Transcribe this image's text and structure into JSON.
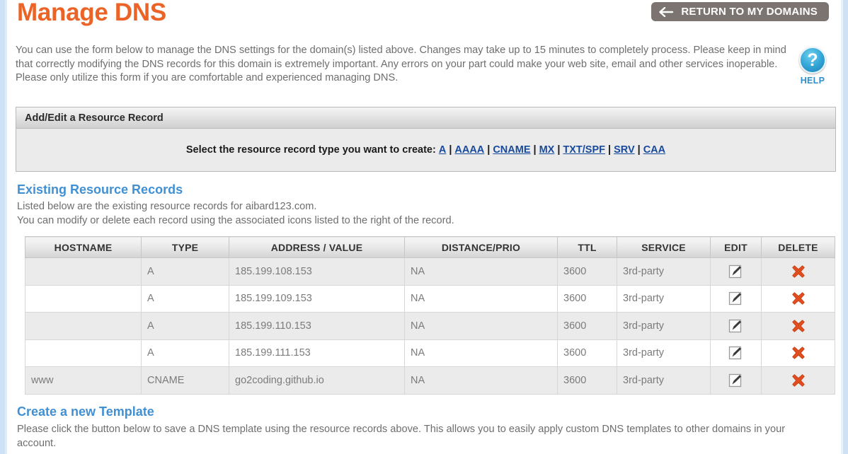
{
  "header": {
    "title": "Manage DNS",
    "return_button": "RETURN TO MY DOMAINS",
    "back_arrow_icon": "arrow-left-icon"
  },
  "intro": "You can use the form below to manage the DNS settings for the domain(s) listed above. Changes may take up to 15 minutes to completely process. Please keep in mind that correctly modifying the DNS records for this domain is extremely important. Any errors on your part could make your web site, email and other services inoperable. Please only utilize this form if you are comfortable and experienced managing DNS.",
  "help": {
    "glyph": "?",
    "label": "HELP",
    "icon": "question-mark-icon",
    "color": "#2d8fd0"
  },
  "add_edit_panel": {
    "title": "Add/Edit a Resource Record",
    "prompt": "Select the resource record type you want to create:",
    "record_types": [
      "A",
      "AAAA",
      "CNAME",
      "MX",
      "TXT/SPF",
      "SRV",
      "CAA"
    ],
    "separator": "|",
    "link_color": "#17499c"
  },
  "existing_records": {
    "heading": "Existing Resource Records",
    "subtext_line1": "Listed below are the existing resource records for aibard123.com.",
    "subtext_line2": "You can modify or delete each record using the associated icons listed to the right of the record.",
    "columns": [
      "HOSTNAME",
      "TYPE",
      "ADDRESS / VALUE",
      "DISTANCE/PRIO",
      "TTL",
      "SERVICE",
      "EDIT",
      "DELETE"
    ],
    "rows": [
      {
        "hostname": "",
        "type": "A",
        "address": "185.199.108.153",
        "distance": "NA",
        "ttl": "3600",
        "service": "3rd-party",
        "edit_icon": "edit-pencil-icon",
        "delete_icon": "delete-x-icon"
      },
      {
        "hostname": "",
        "type": "A",
        "address": "185.199.109.153",
        "distance": "NA",
        "ttl": "3600",
        "service": "3rd-party",
        "edit_icon": "edit-pencil-icon",
        "delete_icon": "delete-x-icon"
      },
      {
        "hostname": "",
        "type": "A",
        "address": "185.199.110.153",
        "distance": "NA",
        "ttl": "3600",
        "service": "3rd-party",
        "edit_icon": "edit-pencil-icon",
        "delete_icon": "delete-x-icon"
      },
      {
        "hostname": "",
        "type": "A",
        "address": "185.199.111.153",
        "distance": "NA",
        "ttl": "3600",
        "service": "3rd-party",
        "edit_icon": "edit-pencil-icon",
        "delete_icon": "delete-x-icon"
      },
      {
        "hostname": "www",
        "type": "CNAME",
        "address": "go2coding.github.io",
        "distance": "NA",
        "ttl": "3600",
        "service": "3rd-party",
        "edit_icon": "edit-pencil-icon",
        "delete_icon": "delete-x-icon"
      }
    ]
  },
  "create_template": {
    "heading": "Create a new Template",
    "subtext": "Please click the button below to save a DNS template using the resource records above. This allows you to easily apply custom DNS templates to other domains in your account."
  },
  "colors": {
    "title_orange": "#ec6327",
    "heading_blue": "#4190d3",
    "delete_red": "#e04d1f",
    "button_gray": "#7c7470"
  }
}
